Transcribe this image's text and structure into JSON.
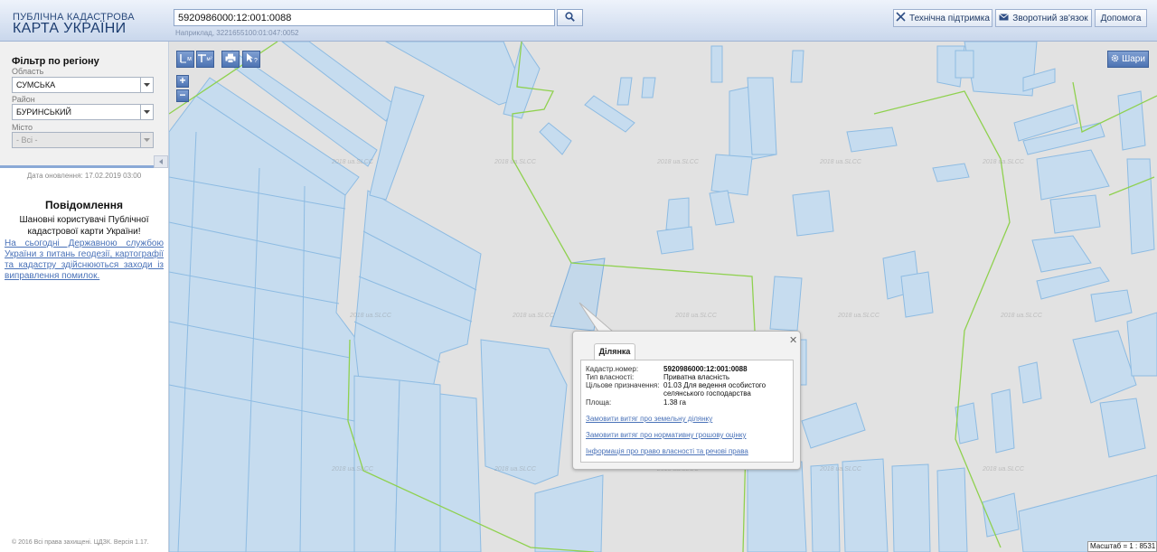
{
  "header": {
    "logo_top": "ПУБЛІЧНА КАДАСТРОВА",
    "logo_bottom": "КАРТА УКРАЇНИ",
    "search_value": "5920986000:12:001:0088",
    "search_hint": "Наприклад, 3221655100:01:047:0052",
    "buttons": {
      "support": "Технічна підтримка",
      "feedback": "Зворотний зв'язок",
      "help": "Допомога"
    }
  },
  "filter": {
    "title": "Фільтр по регіону",
    "region_label": "Область",
    "region_value": "СУМСЬКА",
    "district_label": "Район",
    "district_value": "БУРИНСЬКИЙ",
    "city_label": "Місто",
    "city_value": "- Всі -"
  },
  "sidebar": {
    "update_date": "Дата оновлення: 17.02.2019 03:00",
    "notice_title": "Повідомлення",
    "notice_greeting": "Шановні користувачі Публічної кадастрової карти України!",
    "notice_link": "На сьогодні Державною службою України з питань геодезії, картографії та кадастру здійснюються заходи із виправлення помилок.",
    "footer": "© 2016 Всі права захищені. ЦДЗК. Версія 1.17."
  },
  "map": {
    "tools": {
      "measure_line": "м",
      "measure_area": "м²"
    },
    "layers_label": "Шари",
    "scale": "Масштаб = 1 : 8531",
    "watermark": "2018 ua.SLCC"
  },
  "popup": {
    "tab": "Ділянка",
    "rows": [
      {
        "label": "Кадастр.номер:",
        "value": "5920986000:12:001:0088"
      },
      {
        "label": "Тип власності:",
        "value": "Приватна власність"
      },
      {
        "label": "Цільове призначення:",
        "value": "01.03 Для ведення особистого селянського господарства"
      },
      {
        "label": "Площа:",
        "value": "1.38 га"
      }
    ],
    "links": [
      "Замовити витяг про земельну ділянку",
      "Замовити витяг про нормативну грошову оцінку",
      "Інформація про право власності та речові права"
    ]
  },
  "colors": {
    "parcel_fill": "#c6dcef",
    "parcel_stroke": "#8dbbe2",
    "boundary": "#8fd14f",
    "map_bg": "#e2e2e2",
    "link": "#4a72b8"
  }
}
